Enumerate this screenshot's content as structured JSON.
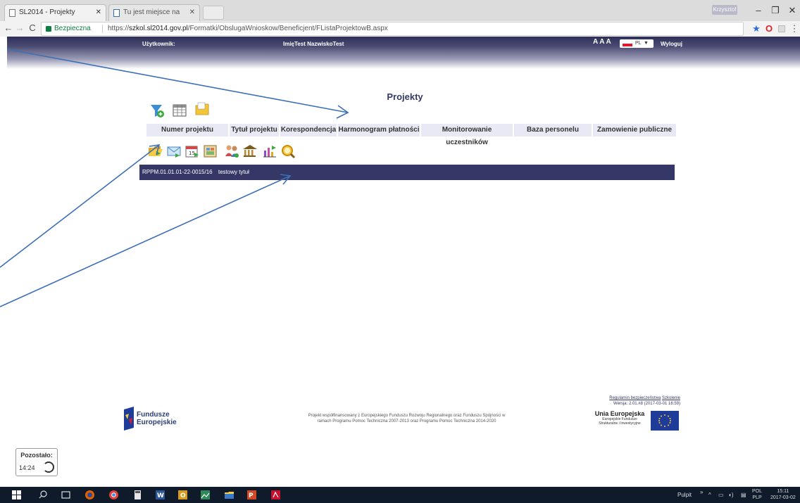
{
  "browser": {
    "tabs": [
      {
        "label": "SL2014 - Projekty",
        "close": "✕"
      },
      {
        "label": "Tu jest miejsce na logotyj",
        "close": "✕"
      }
    ],
    "user_chip": "Krzysztof",
    "window": {
      "minimize": "–",
      "maximize": "❐",
      "close": "✕"
    },
    "nav": {
      "back": "←",
      "forward": "→",
      "reload": "C"
    },
    "secure_label": "Bezpieczna",
    "url_prefix": "https://",
    "url_host": "szkol.sl2014.gov.pl",
    "url_path": "/Formatki/ObslugaWnioskow/Beneficjent/FListaProjektowB.aspx",
    "star": "★",
    "opera": "O"
  },
  "site_header": {
    "user_label": "Użytkownik:",
    "user_name": "ImięTest NazwiskoTest",
    "font_sizes": "A A A",
    "lang": "PL",
    "lang_caret": "▼",
    "logout": "Wyloguj"
  },
  "page": {
    "title": "Projekty",
    "toolbar_icons": [
      "filter-add-icon",
      "table-icon",
      "folder-icon"
    ],
    "columns": [
      "Numer projektu",
      "Tytuł projektu",
      "Korespondencja",
      "Harmonogram płatności",
      "Monitorowanie uczestników",
      "Baza personelu",
      "Zamowienie publiczne"
    ],
    "row_icons": [
      "folder-open-icon",
      "envelope-icon",
      "calendar-icon",
      "schedule-icon",
      "participants-icon",
      "bank-icon",
      "chart-icon",
      "search-icon"
    ],
    "rows": [
      {
        "number": "RPPM.01.01.01-22-0015/16",
        "title": "testowy tytuł"
      }
    ]
  },
  "footer": {
    "fe_line1": "Fundusze",
    "fe_line2": "Europejskie",
    "cofund_line1": "Projekt współfinansowany z Europejskiego Funduszu Rozwoju Regionalnego oraz Funduszu Spójności w",
    "cofund_line2": "ramach Programu Pomoc Techniczna 2007-2013 oraz Programu Pomoc Techniczna 2014-2020",
    "link_regulamin": "Regulamin bezpieczeństwa",
    "link_szkolenie": "Szkolenie",
    "version": "Wersja: 2.01.#8 (2017-03-01 16:59)",
    "ue_title": "Unia Europejska",
    "ue_sub1": "Europejskie Fundusze",
    "ue_sub2": "Strukturalne i Inwestycyjne"
  },
  "session": {
    "label": "Pozostało:",
    "time": "14:24"
  },
  "taskbar": {
    "desktop": "Pulpit",
    "chevron": "»",
    "lang1": "POL",
    "lang2": "PLP",
    "time": "15:11",
    "date": "2017-03-02"
  },
  "colors": {
    "header_dark": "#353866",
    "secure_green": "#0b8043",
    "arrow_blue": "#3d6fb6"
  }
}
